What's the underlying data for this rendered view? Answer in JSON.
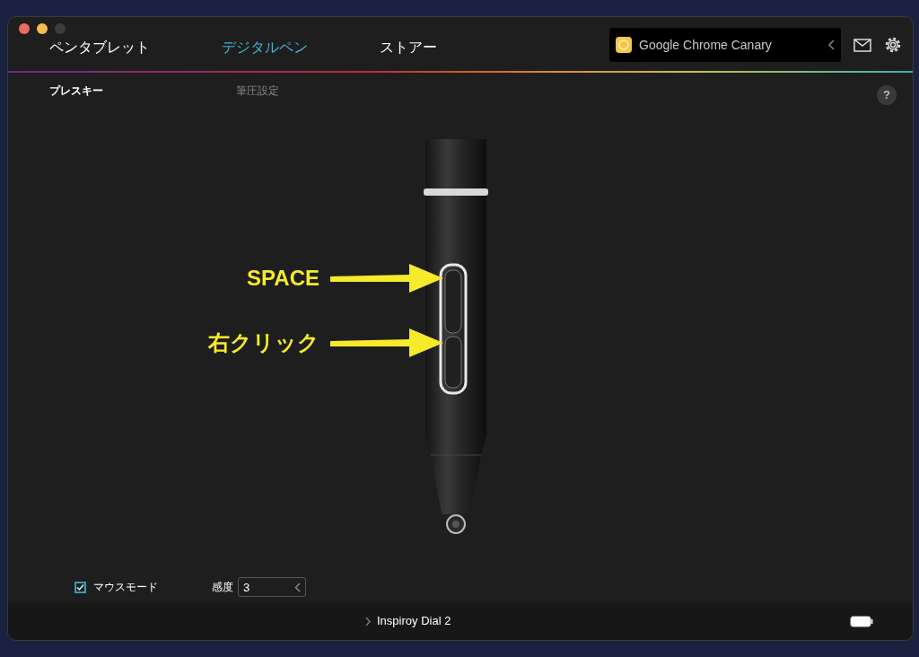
{
  "tabs": [
    {
      "label": "ペンタブレット",
      "selected": false
    },
    {
      "label": "デジタルペン",
      "selected": true
    },
    {
      "label": "ストアー",
      "selected": false
    }
  ],
  "app_selector": {
    "app_name": "Google Chrome Canary"
  },
  "subtabs": [
    {
      "label": "プレスキー",
      "selected": true
    },
    {
      "label": "筆圧設定",
      "selected": false
    }
  ],
  "annotations": [
    {
      "label": "SPACE"
    },
    {
      "label": "右クリック"
    }
  ],
  "mouse_mode": {
    "label": "マウスモード",
    "checked": true
  },
  "sensitivity": {
    "label": "感度",
    "value": "3"
  },
  "help_button": {
    "label": "?"
  },
  "footer": {
    "device": "Inspiroy Dial 2"
  }
}
